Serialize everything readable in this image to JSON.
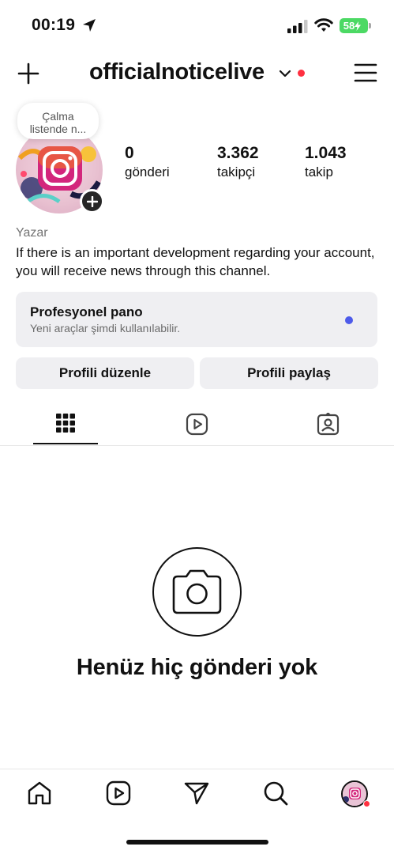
{
  "status_bar": {
    "time": "00:19",
    "battery": "58"
  },
  "header": {
    "username": "officialnoticelive"
  },
  "profile": {
    "note": "Çalma listende n...",
    "stats": [
      {
        "value": "0",
        "label": "gönderi"
      },
      {
        "value": "3.362",
        "label": "takipçi"
      },
      {
        "value": "1.043",
        "label": "takip"
      }
    ],
    "category": "Yazar",
    "bio": "If there is an important development regarding your account, you will receive news through this channel."
  },
  "pro_dashboard": {
    "title": "Profesyonel pano",
    "subtitle": "Yeni araçlar şimdi kullanılabilir."
  },
  "buttons": {
    "edit": "Profili düzenle",
    "share": "Profili paylaş"
  },
  "empty_state": {
    "title": "Henüz hiç gönderi yok"
  },
  "icons": {
    "tabs": [
      "grid-icon",
      "reels-icon",
      "tagged-icon"
    ],
    "nav": [
      "home-icon",
      "reels-icon",
      "send-icon",
      "search-icon",
      "profile-avatar"
    ]
  },
  "colors": {
    "notification_red": "#ff3040",
    "pro_dot": "#4d5bea",
    "battery_green": "#4cd964"
  }
}
